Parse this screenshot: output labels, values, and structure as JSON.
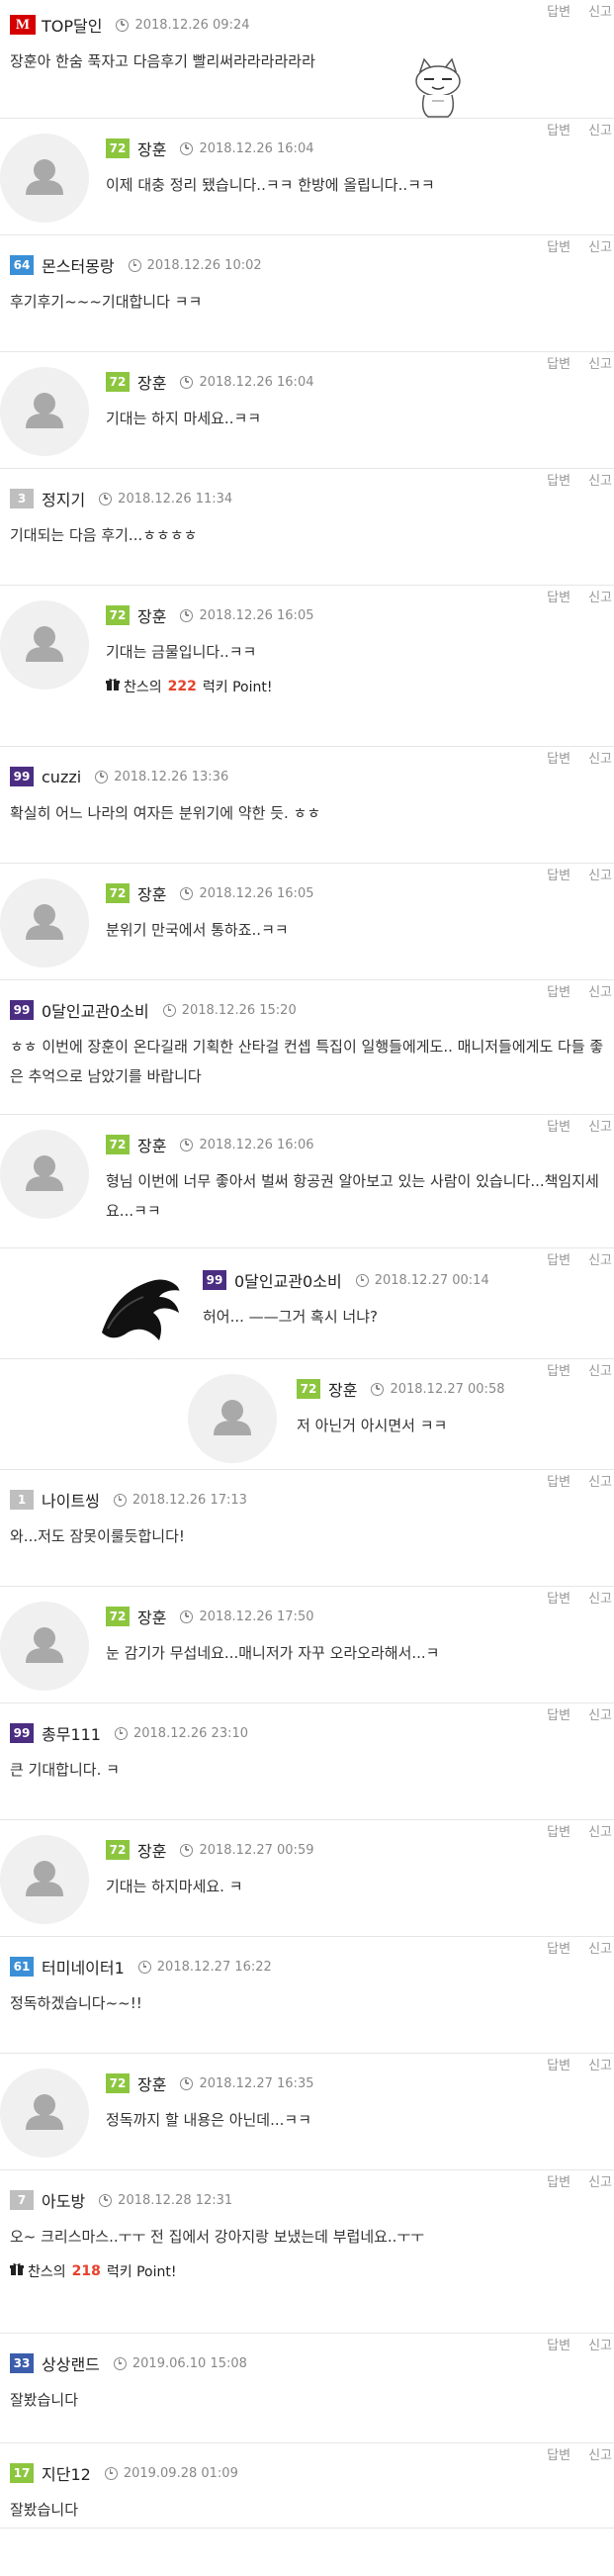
{
  "actions": {
    "reply": "답변",
    "report": "신고"
  },
  "colors": {
    "level_green": "#8cc63f",
    "level_blue": "#3b8fd6",
    "level_purple": "#4b2d82",
    "level_gray": "#bfbfbf",
    "level_darkblue": "#3b5dac",
    "level_teal": "#22a6b3",
    "point_red": "#e8412a"
  },
  "comments": [
    {
      "depth": 0,
      "level": "M",
      "level_color": "#d40000",
      "nick": "TOP달인",
      "date": "2018.12.26 09:24",
      "text": "장훈아 한숨 푹자고 다음후기 빨리써라라라라라라",
      "sticker": "cat-emoticon"
    },
    {
      "depth": 1,
      "level": "72",
      "level_color": "#8cc63f",
      "nick": "장훈",
      "date": "2018.12.26 16:04",
      "text": "이제 대충 정리 됐습니다..ㅋㅋ 한방에 올립니다..ㅋㅋ"
    },
    {
      "depth": 0,
      "level": "64",
      "level_color": "#3b8fd6",
      "nick": "몬스터몽랑",
      "date": "2018.12.26 10:02",
      "text": "후기후기~~~기대합니다 ㅋㅋ"
    },
    {
      "depth": 1,
      "level": "72",
      "level_color": "#8cc63f",
      "nick": "장훈",
      "date": "2018.12.26 16:04",
      "text": "기대는 하지 마세요..ㅋㅋ"
    },
    {
      "depth": 0,
      "level": "3",
      "level_color": "#bfbfbf",
      "nick": "정지기",
      "date": "2018.12.26 11:34",
      "text": "기대되는 다음 후기...ㅎㅎㅎㅎ"
    },
    {
      "depth": 1,
      "level": "72",
      "level_color": "#8cc63f",
      "nick": "장훈",
      "date": "2018.12.26 16:05",
      "text": "기대는 금물입니다..ㅋㅋ",
      "points": {
        "pre": "찬스의",
        "value": "222",
        "post": "럭키 Point!"
      }
    },
    {
      "depth": 0,
      "level": "99",
      "level_color": "#4b2d82",
      "nick": "cuzzi",
      "date": "2018.12.26 13:36",
      "text": "확실히 어느 나라의 여자든 분위기에 약한 듯. ㅎㅎ"
    },
    {
      "depth": 1,
      "level": "72",
      "level_color": "#8cc63f",
      "nick": "장훈",
      "date": "2018.12.26 16:05",
      "text": "분위기 만국에서 통하죠..ㅋㅋ"
    },
    {
      "depth": 0,
      "level": "99",
      "level_color": "#4b2d82",
      "nick": "0달인교관0소비",
      "date": "2018.12.26 15:20",
      "text": "ㅎㅎ 이번에 장훈이 온다길래 기획한 산타걸 컨셉 특집이 일행들에게도.. 매니저들에게도 다들 좋은 추억으로 남았기를 바랍니다"
    },
    {
      "depth": 1,
      "level": "72",
      "level_color": "#8cc63f",
      "nick": "장훈",
      "date": "2018.12.26 16:06",
      "text": "형님 이번에 너무 좋아서 벌써 항공권 알아보고 있는 사람이 있습니다...책임지세요...ㅋㅋ"
    },
    {
      "depth": 2,
      "level": "99",
      "level_color": "#4b2d82",
      "nick": "0달인교관0소비",
      "date": "2018.12.27 00:14",
      "text": "허어... ——그거 혹시 너냐?",
      "avatar": "black"
    },
    {
      "depth": 3,
      "level": "72",
      "level_color": "#8cc63f",
      "nick": "장훈",
      "date": "2018.12.27 00:58",
      "text": "저 아닌거 아시면서 ㅋㅋ"
    },
    {
      "depth": 0,
      "level": "1",
      "level_color": "#bfbfbf",
      "nick": "나이트씽",
      "date": "2018.12.26 17:13",
      "text": "와...저도 잠못이룰듯합니다!"
    },
    {
      "depth": 1,
      "level": "72",
      "level_color": "#8cc63f",
      "nick": "장훈",
      "date": "2018.12.26 17:50",
      "text": "눈 감기가 무섭네요...매니저가 자꾸 오라오라해서...ㅋ"
    },
    {
      "depth": 0,
      "level": "99",
      "level_color": "#4b2d82",
      "nick": "총무111",
      "date": "2018.12.26 23:10",
      "text": "큰 기대합니다. ㅋ"
    },
    {
      "depth": 1,
      "level": "72",
      "level_color": "#8cc63f",
      "nick": "장훈",
      "date": "2018.12.27 00:59",
      "text": "기대는 하지마세요. ㅋ"
    },
    {
      "depth": 0,
      "level": "61",
      "level_color": "#3b8fd6",
      "nick": "터미네이터1",
      "date": "2018.12.27 16:22",
      "text": "정독하겠습니다~~!!"
    },
    {
      "depth": 1,
      "level": "72",
      "level_color": "#8cc63f",
      "nick": "장훈",
      "date": "2018.12.27 16:35",
      "text": "정독까지 할 내용은 아닌데...ㅋㅋ"
    },
    {
      "depth": 0,
      "level": "7",
      "level_color": "#bfbfbf",
      "nick": "아도방",
      "date": "2018.12.28 12:31",
      "text": "오~ 크리스마스..ㅜㅜ 전 집에서 강아지랑 보냈는데 부럽네요..ㅜㅜ",
      "points": {
        "pre": "찬스의",
        "value": "218",
        "post": "럭키 Point!"
      }
    },
    {
      "depth": 0,
      "level": "33",
      "level_color": "#3b5dac",
      "nick": "상상랜드",
      "date": "2019.06.10 15:08",
      "text": "잘봤습니다"
    },
    {
      "depth": 0,
      "level": "17",
      "level_color": "#8cc63f",
      "nick": "지단12",
      "date": "2019.09.28 01:09",
      "text": "잘봤습니다"
    }
  ]
}
